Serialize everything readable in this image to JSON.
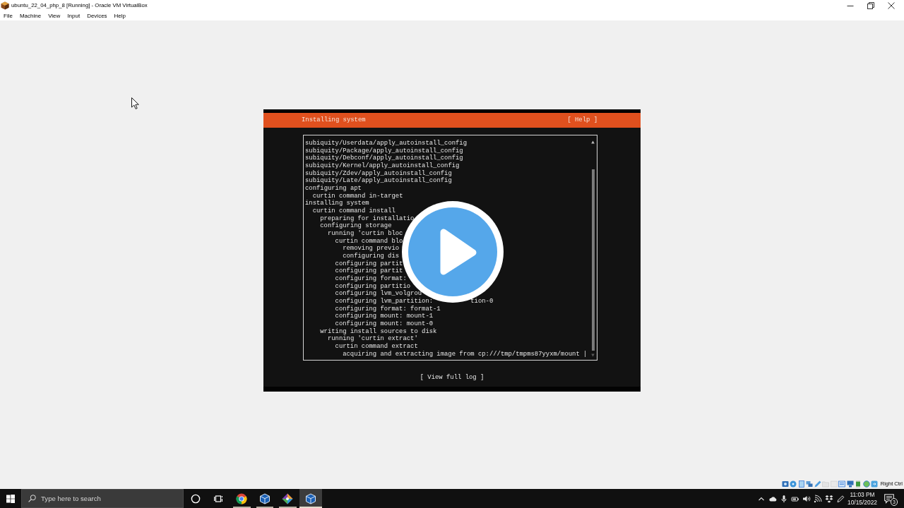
{
  "window": {
    "title": "ubuntu_22_04_php_8 [Running] - Oracle VM VirtualBox"
  },
  "menu": [
    "File",
    "Machine",
    "View",
    "Input",
    "Devices",
    "Help"
  ],
  "installer": {
    "title": "Installing system",
    "help_button": "[ Help ]",
    "log": [
      {
        "text": "subiquity/Userdata/apply_autoinstall_config"
      },
      {
        "text": "subiquity/Package/apply_autoinstall_config"
      },
      {
        "text": "subiquity/Debconf/apply_autoinstall_config"
      },
      {
        "text": "subiquity/Kernel/apply_autoinstall_config"
      },
      {
        "text": "subiquity/Zdev/apply_autoinstall_config"
      },
      {
        "text": "subiquity/Late/apply_autoinstall_config"
      },
      {
        "text": "configuring apt",
        "children": [
          {
            "text": "curtin command in-target"
          }
        ]
      },
      {
        "text": "installing system",
        "children": [
          {
            "text": "curtin command install",
            "children": [
              {
                "text": "preparing for installatio"
              },
              {
                "text": "configuring storage",
                "children": [
                  {
                    "text": "running 'curtin bloc",
                    "children": [
                      {
                        "text": "curtin command blo",
                        "children": [
                          {
                            "text": "removing previo"
                          },
                          {
                            "text": "configuring dis"
                          }
                        ]
                      },
                      {
                        "text": "configuring partit"
                      },
                      {
                        "text": "configuring partit"
                      },
                      {
                        "text": "configuring format:"
                      },
                      {
                        "text": "configuring partitio"
                      },
                      {
                        "text": "configuring lvm_volgrou"
                      },
                      {
                        "text": "configuring lvm_partition:",
                        "tail": "tion-0"
                      },
                      {
                        "text": "configuring format: format-1"
                      },
                      {
                        "text": "configuring mount: mount-1"
                      },
                      {
                        "text": "configuring mount: mount-0"
                      }
                    ]
                  }
                ]
              },
              {
                "text": "writing install sources to disk",
                "children": [
                  {
                    "text": "running 'curtin extract'",
                    "children": [
                      {
                        "text": "curtin command extract",
                        "children": [
                          {
                            "text": "acquiring and extracting image from cp:///tmp/tmpms87yyxm/mount |"
                          }
                        ]
                      }
                    ]
                  }
                ]
              }
            ]
          }
        ]
      }
    ],
    "view_log_button": "[ View full log ]"
  },
  "status_bar": {
    "host_key": "Right Ctrl"
  },
  "taskbar": {
    "search": {
      "placeholder": "Type here to search"
    },
    "apps": [
      {
        "kind": "browser",
        "running": true,
        "selected": false
      },
      {
        "kind": "cube",
        "running": true,
        "selected": false
      },
      {
        "kind": "diamond",
        "running": true,
        "selected": false
      },
      {
        "kind": "cube",
        "running": true,
        "selected": true
      }
    ],
    "clock": {
      "time": "11:03 PM",
      "date": "10/15/2022"
    },
    "notifications": {
      "count": "3"
    }
  }
}
